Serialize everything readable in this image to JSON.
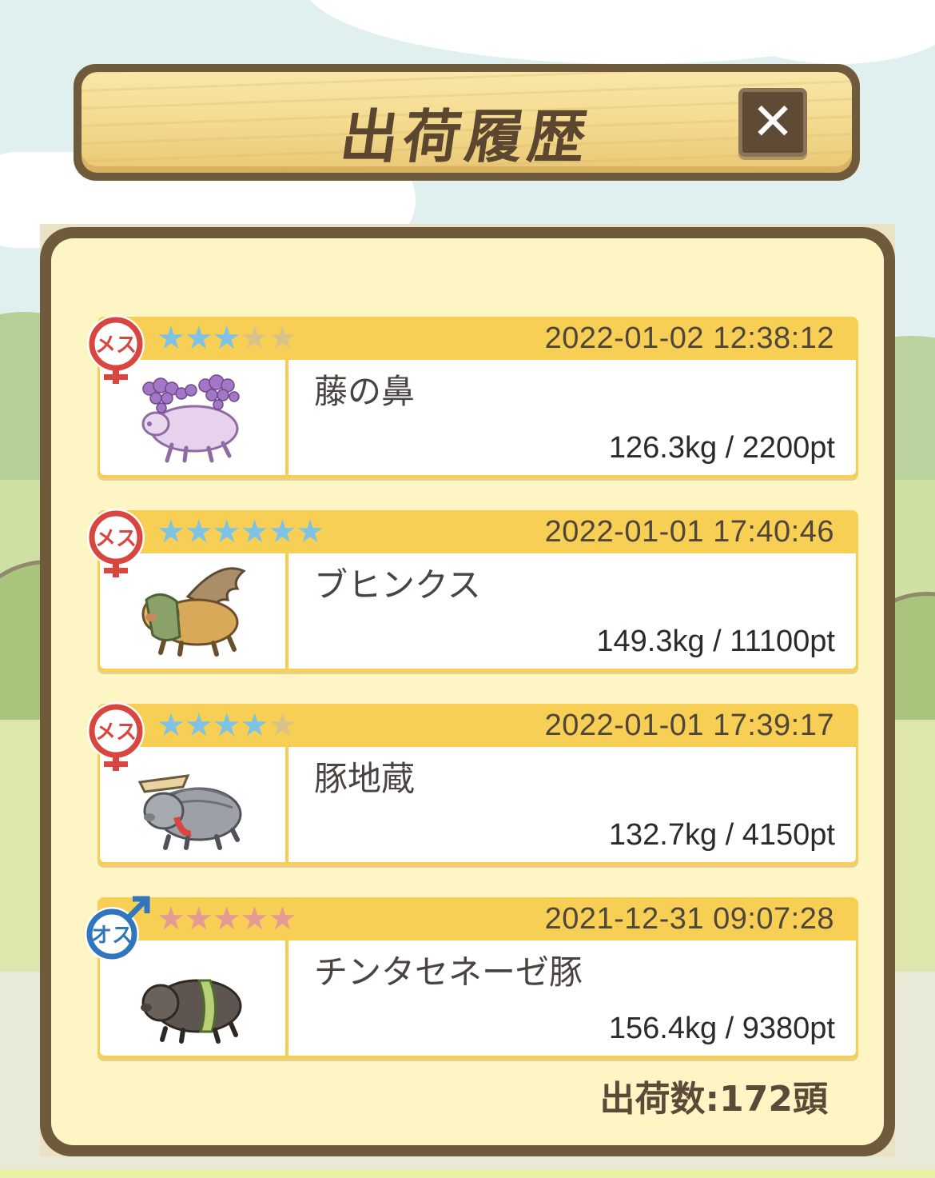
{
  "header": {
    "title": "出荷履歴",
    "close_icon": "close-icon"
  },
  "colors": {
    "frame": "#6f5a3c",
    "panel": "#fdf6c4",
    "card_header": "#f7cf55",
    "star_blue": "#7ec3e6",
    "star_pink": "#e59a93",
    "female": "#d9453f",
    "male": "#2f76bf"
  },
  "history": [
    {
      "gender": "female",
      "gender_label": "メス",
      "stars_filled": 3,
      "stars_total": 5,
      "star_color": "blue",
      "timestamp": "2022-01-02 12:38:12",
      "name": "藤の鼻",
      "weight_pt": "126.3kg / 2200pt",
      "icon": "wisteria-pig-icon"
    },
    {
      "gender": "female",
      "gender_label": "メス",
      "stars_filled": 6,
      "stars_total": 6,
      "star_color": "blue",
      "timestamp": "2022-01-01 17:40:46",
      "name": "ブヒンクス",
      "weight_pt": "149.3kg / 11100pt",
      "icon": "sphinx-pig-icon"
    },
    {
      "gender": "female",
      "gender_label": "メス",
      "stars_filled": 4,
      "stars_total": 5,
      "star_color": "blue",
      "timestamp": "2022-01-01 17:39:17",
      "name": "豚地蔵",
      "weight_pt": "132.7kg / 4150pt",
      "icon": "jizo-pig-icon"
    },
    {
      "gender": "male",
      "gender_label": "オス",
      "stars_filled": 5,
      "stars_total": 5,
      "star_color": "pink",
      "timestamp": "2021-12-31 09:07:28",
      "name": "チンタセネーゼ豚",
      "weight_pt": "156.4kg / 9380pt",
      "icon": "cinta-senese-pig-icon"
    }
  ],
  "footer": {
    "total": "出荷数:172頭"
  }
}
